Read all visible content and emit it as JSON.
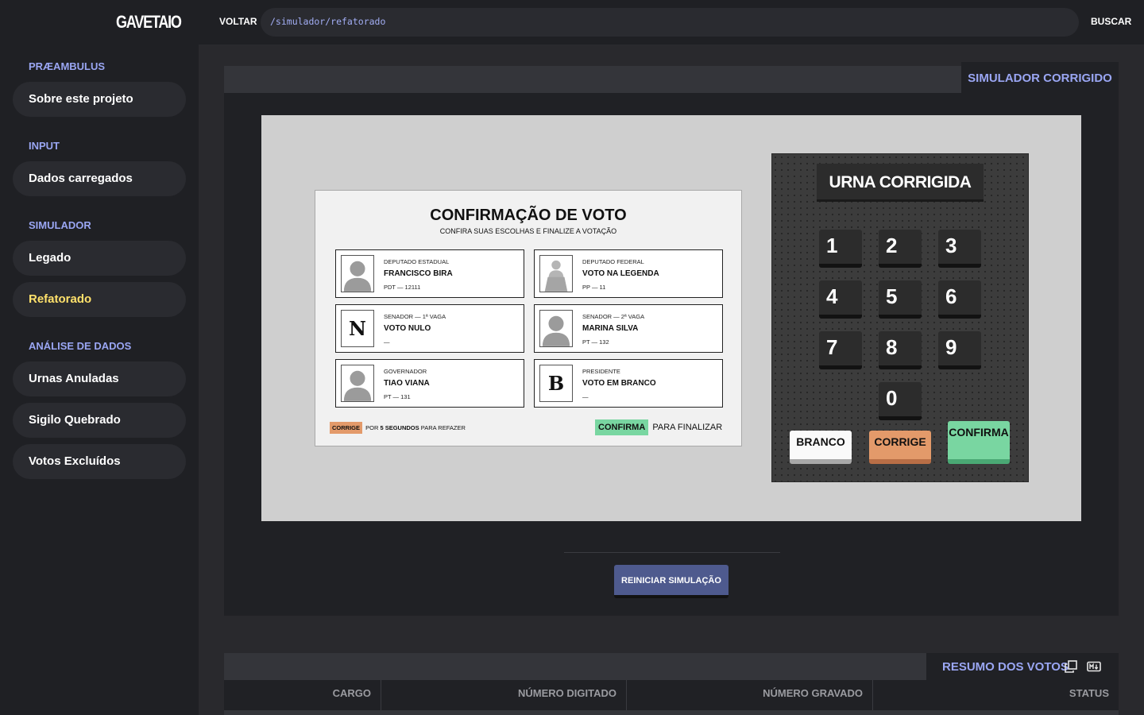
{
  "header": {
    "logo": "GAVETAIO",
    "back_label": "VOLTAR",
    "path": "/simulador/refatorado",
    "search_label": "BUSCAR"
  },
  "sidebar": {
    "sections": [
      {
        "title": "PRÆAMBULUS",
        "items": [
          "Sobre este projeto"
        ]
      },
      {
        "title": "INPUT",
        "items": [
          "Dados carregados"
        ]
      },
      {
        "title": "SIMULADOR",
        "items": [
          "Legado",
          "Refatorado"
        ]
      },
      {
        "title": "ANÁLISE DE DADOS",
        "items": [
          "Urnas Anuladas",
          "Sigilo Quebrado",
          "Votos Excluídos"
        ]
      }
    ],
    "active_item": "Refatorado"
  },
  "simulator": {
    "tab_label": "SIMULADOR CORRIGIDO",
    "screen": {
      "title": "CONFIRMAÇÃO DE VOTO",
      "subtitle": "CONFIRA SUAS ESCOLHAS E FINALIZE A VOTAÇÃO",
      "cards": [
        {
          "role": "DEPUTADO ESTADUAL",
          "name": "FRANCISCO BIRA",
          "detail": "PDT — 12111",
          "avatar": "person-icon"
        },
        {
          "role": "DEPUTADO FEDERAL",
          "name": "VOTO NA LEGENDA",
          "detail": "PP — 11",
          "avatar": "podium-icon"
        },
        {
          "role": "SENADOR — 1ª VAGA",
          "name": "VOTO NULO",
          "detail": "—",
          "avatar": "N"
        },
        {
          "role": "SENADOR — 2ª VAGA",
          "name": "MARINA SILVA",
          "detail": "PT — 132",
          "avatar": "person-icon"
        },
        {
          "role": "GOVERNADOR",
          "name": "TIAO VIANA",
          "detail": "PT — 131",
          "avatar": "person-icon"
        },
        {
          "role": "PRESIDENTE",
          "name": "VOTO EM BRANCO",
          "detail": "—",
          "avatar": "B"
        }
      ],
      "hint_left": {
        "tag": "CORRIGE",
        "text_a": "POR",
        "text_b": "5 SEGUNDOS",
        "text_c": "PARA REFAZER"
      },
      "hint_right": {
        "tag": "CONFIRMA",
        "text": "PARA FINALIZAR"
      }
    },
    "machine": {
      "label": "URNA CORRIGIDA",
      "keys": [
        "1",
        "2",
        "3",
        "4",
        "5",
        "6",
        "7",
        "8",
        "9",
        "0"
      ],
      "branco": "BRANCO",
      "corrige": "CORRIGE",
      "confirma": "CONFIRMA"
    },
    "restart_label": "REINICIAR SIMULAÇÃO"
  },
  "summary": {
    "tab_label": "RESUMO DOS VOTOS",
    "columns": [
      "CARGO",
      "NÚMERO DIGITADO",
      "NÚMERO GRAVADO",
      "STATUS"
    ]
  },
  "colors": {
    "accent": "#9aa6f3",
    "active": "#ffe16b",
    "corrige": "#e39a6a",
    "confirma": "#79d6a1",
    "restart": "#4e5a8e"
  }
}
